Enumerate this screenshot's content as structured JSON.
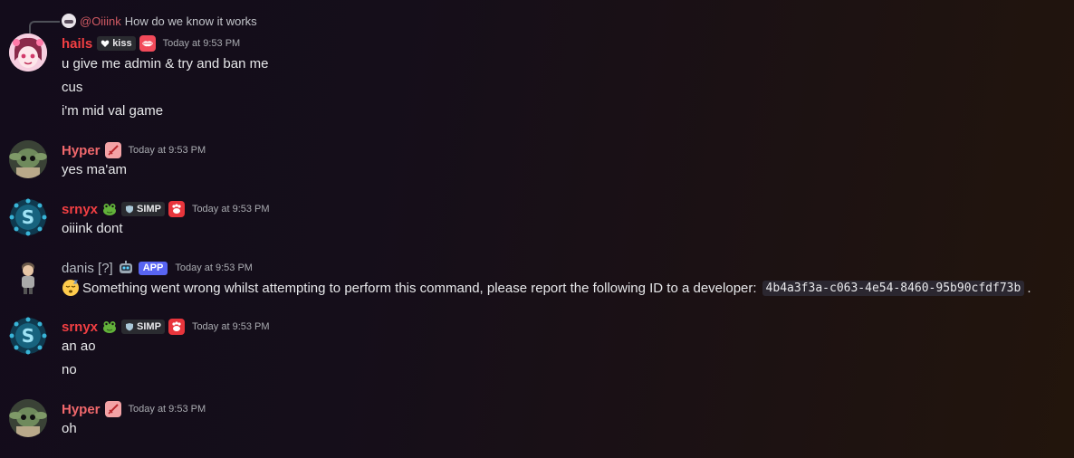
{
  "reply": {
    "mention": "@Oiiink",
    "text": "How do we know it works"
  },
  "messages": [
    {
      "author": "hails",
      "author_color": "#f23f43",
      "tag": "kiss",
      "timestamp": "Today at 9:53 PM",
      "lines": [
        "u give me admin & try and ban me",
        "cus",
        "i'm mid val game"
      ]
    },
    {
      "author": "Hyper",
      "author_color": "#f0686c",
      "timestamp": "Today at 9:53 PM",
      "lines": [
        "yes ma'am"
      ]
    },
    {
      "author": "srnyx",
      "author_color": "#f23f43",
      "tag": "SIMP",
      "timestamp": "Today at 9:53 PM",
      "lines": [
        "oiiink dont"
      ]
    },
    {
      "author": "danis [?]",
      "author_color": "#b5bac1",
      "badge": "APP",
      "timestamp": "Today at 9:53 PM",
      "text": "Something went wrong whilst attempting to perform this command, please report the following ID to a developer:",
      "code": "4b4a3f3a-c063-4e54-8460-95b90cfdf73b",
      "suffix": "."
    },
    {
      "author": "srnyx",
      "author_color": "#f23f43",
      "tag": "SIMP",
      "timestamp": "Today at 9:53 PM",
      "lines": [
        "an ao",
        "no"
      ]
    },
    {
      "author": "Hyper",
      "author_color": "#f0686c",
      "timestamp": "Today at 9:53 PM",
      "lines": [
        "oh"
      ]
    }
  ]
}
